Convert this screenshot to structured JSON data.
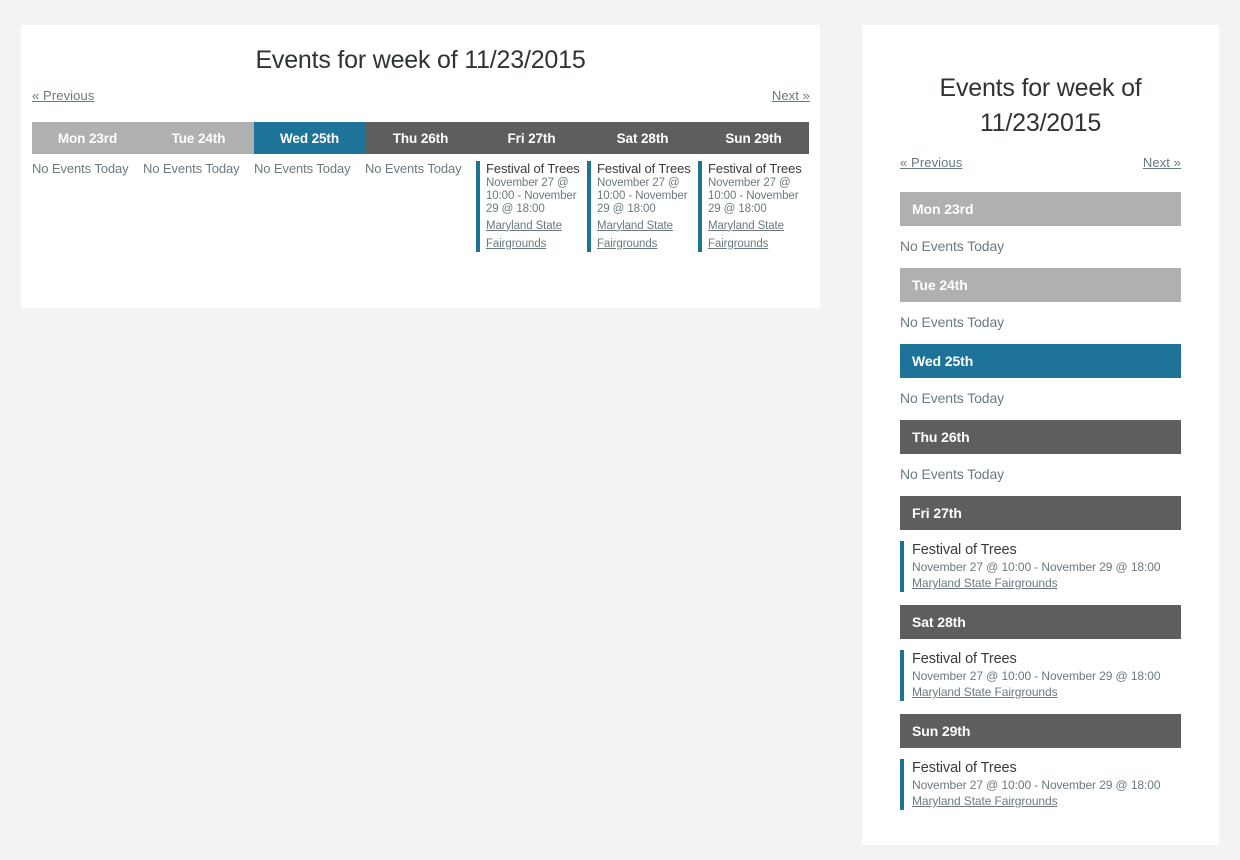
{
  "page": {
    "background_color": "#f3f3f3"
  },
  "colors": {
    "accent_blue": "#1e7498",
    "past_day_gray": "#b0b0b0",
    "future_day_gray": "#5e5e5e",
    "muted_text": "#6b7a80",
    "title_text": "#2e3436"
  },
  "wide_view": {
    "title": "Events for week of 11/23/2015",
    "prev_label": "« Previous",
    "next_label": "Next »",
    "days": [
      {
        "label": "Mon 23rd",
        "state": "past",
        "empty_label": "No Events Today",
        "events": []
      },
      {
        "label": "Tue 24th",
        "state": "past",
        "empty_label": "No Events Today",
        "events": []
      },
      {
        "label": "Wed 25th",
        "state": "today",
        "empty_label": "No Events Today",
        "events": []
      },
      {
        "label": "Thu 26th",
        "state": "future",
        "empty_label": "No Events Today",
        "events": []
      },
      {
        "label": "Fri 27th",
        "state": "future",
        "empty_label": "No Events Today",
        "events": [
          {
            "title": "Festival of Trees",
            "time": "November 27 @ 10:00 - November 29 @ 18:00",
            "venue": "Maryland State Fairgrounds"
          }
        ]
      },
      {
        "label": "Sat 28th",
        "state": "future",
        "empty_label": "No Events Today",
        "events": [
          {
            "title": "Festival of Trees",
            "time": "November 27 @ 10:00 - November 29 @ 18:00",
            "venue": "Maryland State Fairgrounds"
          }
        ]
      },
      {
        "label": "Sun 29th",
        "state": "future",
        "empty_label": "No Events Today",
        "events": [
          {
            "title": "Festival of Trees",
            "time": "November 27 @ 10:00 - November 29 @ 18:00",
            "venue": "Maryland State Fairgrounds"
          }
        ]
      }
    ]
  },
  "narrow_view": {
    "title": "Events for week of 11/23/2015",
    "prev_label": "« Previous",
    "next_label": "Next »",
    "days": [
      {
        "label": "Mon 23rd",
        "state": "past",
        "empty_label": "No Events Today",
        "events": []
      },
      {
        "label": "Tue 24th",
        "state": "past",
        "empty_label": "No Events Today",
        "events": []
      },
      {
        "label": "Wed 25th",
        "state": "today",
        "empty_label": "No Events Today",
        "events": []
      },
      {
        "label": "Thu 26th",
        "state": "future",
        "empty_label": "No Events Today",
        "events": []
      },
      {
        "label": "Fri 27th",
        "state": "future",
        "empty_label": "No Events Today",
        "events": [
          {
            "title": "Festival of Trees",
            "time": "November 27 @ 10:00 - November 29 @ 18:00",
            "venue": "Maryland State Fairgrounds"
          }
        ]
      },
      {
        "label": "Sat 28th",
        "state": "future",
        "empty_label": "No Events Today",
        "events": [
          {
            "title": "Festival of Trees",
            "time": "November 27 @ 10:00 - November 29 @ 18:00",
            "venue": "Maryland State Fairgrounds"
          }
        ]
      },
      {
        "label": "Sun 29th",
        "state": "future",
        "empty_label": "No Events Today",
        "events": [
          {
            "title": "Festival of Trees",
            "time": "November 27 @ 10:00 - November 29 @ 18:00",
            "venue": "Maryland State Fairgrounds"
          }
        ]
      }
    ]
  }
}
